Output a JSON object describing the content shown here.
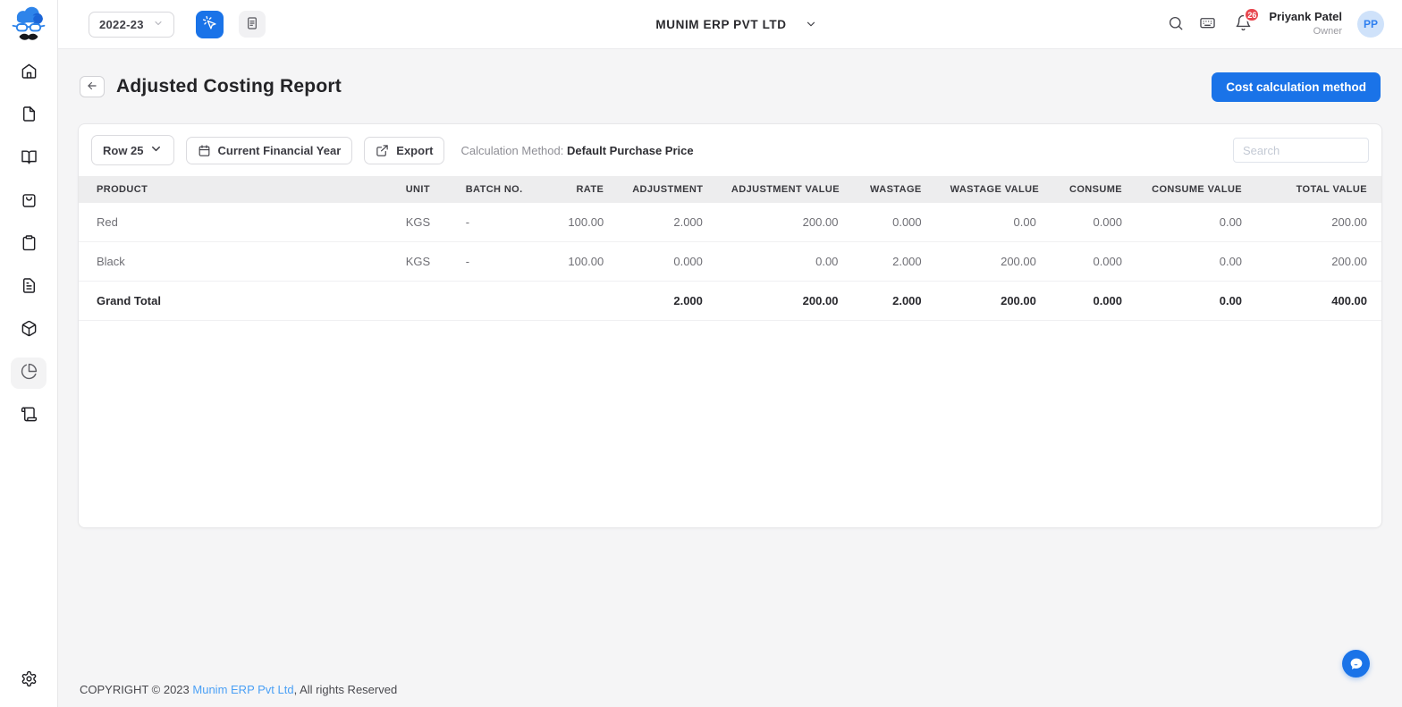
{
  "topbar": {
    "year_selector": "2022-23",
    "company_name": "MUNIM ERP PVT LTD",
    "notification_count": "26",
    "user_name": "Priyank Patel",
    "user_role": "Owner",
    "avatar_initials": "PP",
    "icons": [
      "click-action-icon",
      "notes-icon",
      "search-icon",
      "keyboard-icon",
      "bell-icon"
    ]
  },
  "sidebar": {
    "logo": "munim-cloud-mustache-logo",
    "items": [
      {
        "icon": "home-icon",
        "active": false
      },
      {
        "icon": "document-icon",
        "active": false
      },
      {
        "icon": "book-icon",
        "active": false
      },
      {
        "icon": "shopping-bag-icon",
        "active": false
      },
      {
        "icon": "clipboard-icon",
        "active": false
      },
      {
        "icon": "invoice-icon",
        "active": false
      },
      {
        "icon": "package-icon",
        "active": false
      },
      {
        "icon": "pie-chart-icon",
        "active": true
      },
      {
        "icon": "receipt-scroll-icon",
        "active": false
      }
    ],
    "bottom_icon": "settings-gear-icon"
  },
  "page": {
    "title": "Adjusted Costing Report",
    "cost_calculation_button": "Cost calculation method"
  },
  "toolbar": {
    "row_selector": "Row 25",
    "financial_year_button": "Current Financial Year",
    "export_button": "Export",
    "calculation_method_label": "Calculation Method:",
    "calculation_method_value": "Default Purchase Price",
    "search_placeholder": "Search"
  },
  "table": {
    "headers": [
      "PRODUCT",
      "UNIT",
      "BATCH NO.",
      "RATE",
      "ADJUSTMENT",
      "ADJUSTMENT VALUE",
      "WASTAGE",
      "WASTAGE VALUE",
      "CONSUME",
      "CONSUME VALUE",
      "TOTAL VALUE"
    ],
    "rows": [
      {
        "product": "Red",
        "unit": "KGS",
        "batch_no": "-",
        "rate": "100.00",
        "adjustment": "2.000",
        "adjustment_value": "200.00",
        "wastage": "0.000",
        "wastage_value": "0.00",
        "consume": "0.000",
        "consume_value": "0.00",
        "total_value": "200.00"
      },
      {
        "product": "Black",
        "unit": "KGS",
        "batch_no": "-",
        "rate": "100.00",
        "adjustment": "0.000",
        "adjustment_value": "0.00",
        "wastage": "2.000",
        "wastage_value": "200.00",
        "consume": "0.000",
        "consume_value": "0.00",
        "total_value": "200.00"
      }
    ],
    "grand_total": {
      "label": "Grand Total",
      "unit": "",
      "batch_no": "",
      "rate": "",
      "adjustment": "2.000",
      "adjustment_value": "200.00",
      "wastage": "2.000",
      "wastage_value": "200.00",
      "consume": "0.000",
      "consume_value": "0.00",
      "total_value": "400.00"
    }
  },
  "footer": {
    "copyright_prefix": "COPYRIGHT © 2023 ",
    "company_link": "Munim ERP Pvt Ltd",
    "copyright_suffix": ", All rights Reserved"
  },
  "colors": {
    "accent_blue": "#1a73e8",
    "badge_red": "#e8474f",
    "avatar_bg": "#cfe2fa",
    "avatar_text": "#2d7ff0",
    "link_blue": "#4ba0f5",
    "page_bg": "#f5f5f6",
    "table_header_bg": "#ededee"
  }
}
